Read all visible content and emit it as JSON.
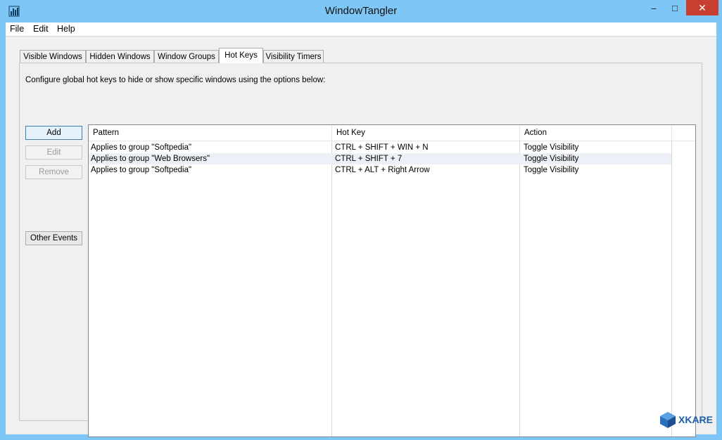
{
  "window": {
    "title": "WindowTangler",
    "controls": {
      "minimize": "–",
      "maximize": "□",
      "close": "✕"
    }
  },
  "menu": [
    "File",
    "Edit",
    "Help"
  ],
  "tabs": [
    {
      "label": "Visible Windows",
      "active": false
    },
    {
      "label": "Hidden Windows",
      "active": false
    },
    {
      "label": "Window Groups",
      "active": false
    },
    {
      "label": "Hot Keys",
      "active": true
    },
    {
      "label": "Visibility Timers",
      "active": false
    }
  ],
  "hotkeys": {
    "description": "Configure global hot keys to hide or show specific windows using the options below:",
    "buttons": {
      "add": "Add",
      "edit": "Edit",
      "remove": "Remove",
      "other_events": "Other Events"
    },
    "columns": [
      "Pattern",
      "Hot Key",
      "Action"
    ],
    "rows": [
      {
        "pattern": "Applies to group \"Softpedia\"",
        "hotkey": "CTRL + SHIFT + WIN + N",
        "action": "Toggle Visibility"
      },
      {
        "pattern": "Applies to group \"Web Browsers\"",
        "hotkey": "CTRL + SHIFT + 7",
        "action": "Toggle Visibility"
      },
      {
        "pattern": "Applies to group \"Softpedia\"",
        "hotkey": "CTRL + ALT + Right Arrow",
        "action": "Toggle Visibility"
      }
    ]
  },
  "watermark": {
    "text": "XKARE"
  },
  "colors": {
    "titlebar": "#7dc6f5",
    "close": "#c7402f",
    "selection": "#eef0f8"
  }
}
